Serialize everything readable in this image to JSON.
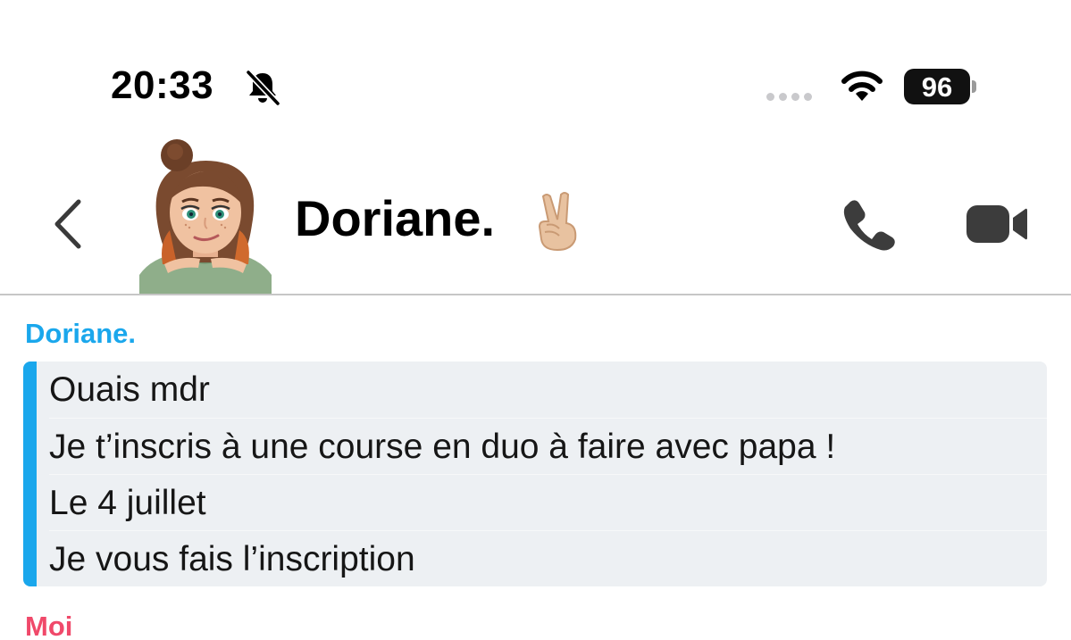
{
  "status_bar": {
    "time": "20:33",
    "silent_icon": "bell-slash-icon",
    "wifi_icon": "wifi-icon",
    "battery_level": "96"
  },
  "header": {
    "back_icon": "chevron-left-icon",
    "contact_name": "Doriane.",
    "name_emoji": "victory-hand-emoji",
    "call_icon": "phone-icon",
    "video_icon": "video-camera-icon"
  },
  "conversation": {
    "groups": [
      {
        "sender": "Doriane.",
        "accent_color": "#1aa7ec",
        "messages": [
          "Ouais mdr",
          "Je t’inscris à une course en duo à faire avec papa !",
          "Le 4 juillet",
          "Je vous fais l’inscription"
        ]
      },
      {
        "sender": "Moi",
        "accent_color": "#f0496a",
        "messages": []
      }
    ]
  }
}
